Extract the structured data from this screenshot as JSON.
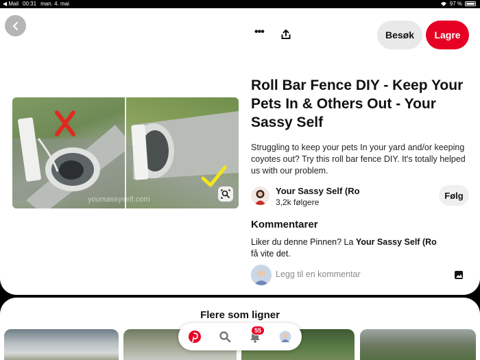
{
  "status_bar": {
    "back_app": "Mail",
    "time": "00:31",
    "date": "man. 4. mai",
    "battery": "97 %",
    "battery_level": 0.97
  },
  "header": {
    "more_icon": "more-horizontal-icon",
    "share_icon": "share-upload-icon",
    "visit_label": "Besøk",
    "save_label": "Lagre"
  },
  "pin": {
    "title": "Roll Bar Fence DIY - Keep Your Pets In & Others Out - Your Sassy Self",
    "description": "Struggling to keep your pets In your yard and/or keeping coyotes out? Try this roll bar fence DIY. It's totally helped us with our problem.",
    "image_watermark": "yoursassyself.com"
  },
  "author": {
    "name": "Your Sassy Self (Ro",
    "followers": "3,2k følgere",
    "follow_label": "Følg"
  },
  "comments": {
    "heading": "Kommentarer",
    "prompt_prefix": "Liker du denne Pinnen? La ",
    "prompt_author": "Your Sassy Self (Ro",
    "prompt_suffix": "få vite det.",
    "input_placeholder": "Legg til en kommentar"
  },
  "more_like_this": {
    "heading": "Flere som ligner"
  },
  "bottom_nav": {
    "notifications_badge": "55"
  },
  "colors": {
    "brand_red": "#e60023",
    "visit_bg": "#e9e9e9",
    "back_btn_bg": "#b5b5b5"
  }
}
